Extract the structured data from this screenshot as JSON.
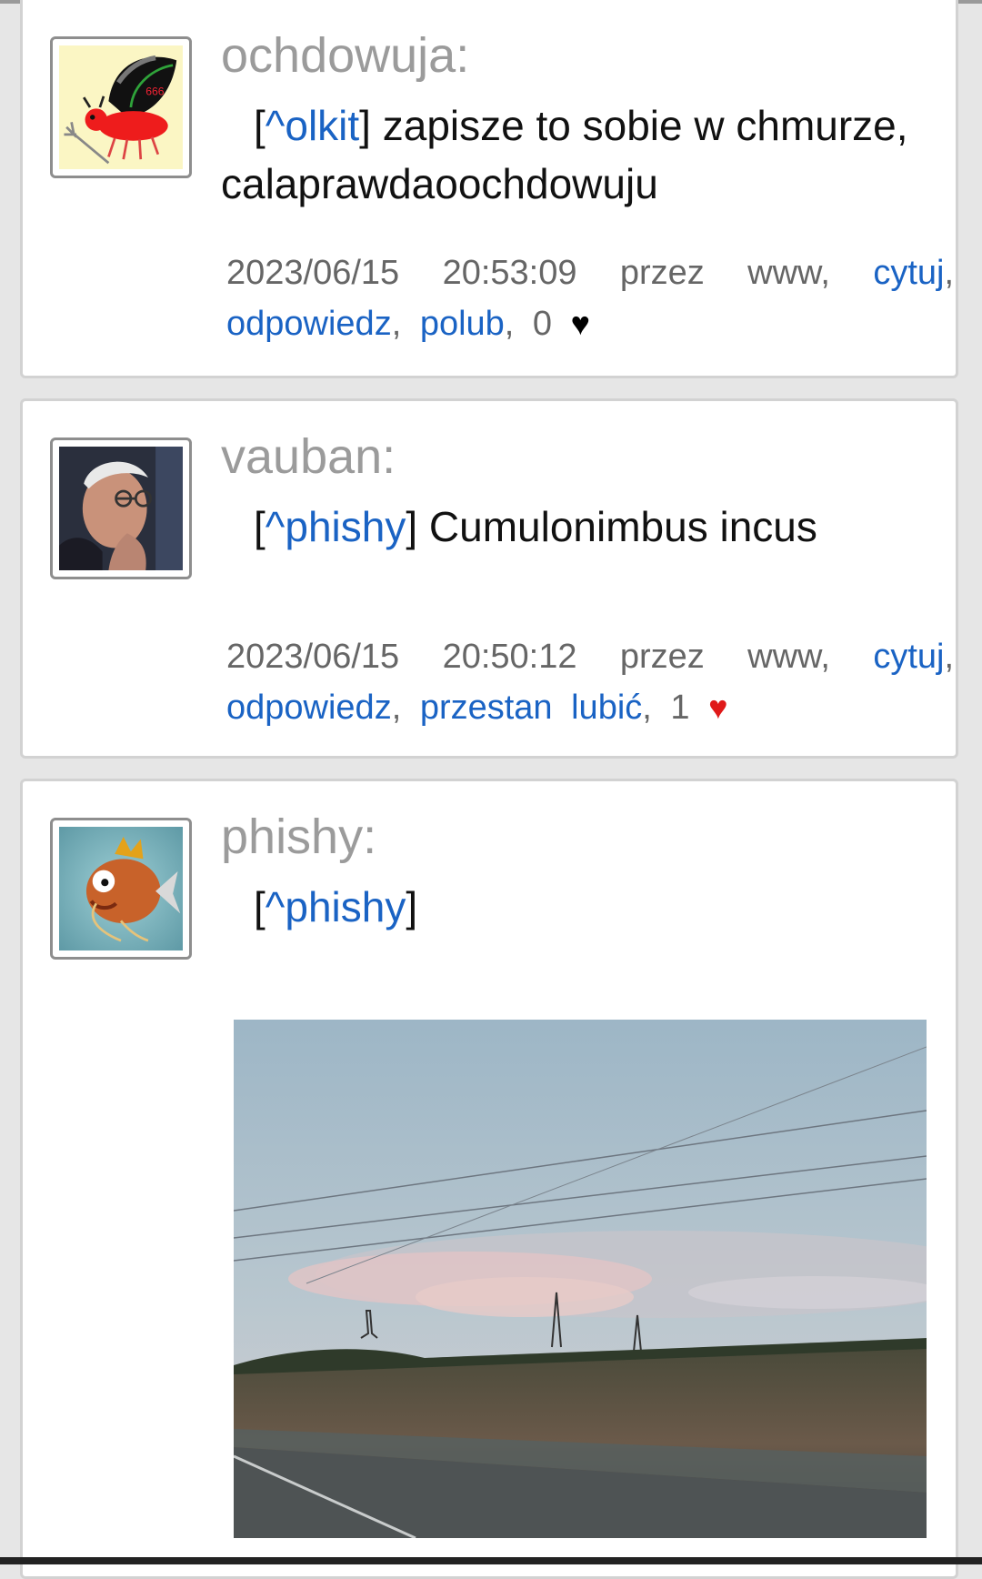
{
  "posts": [
    {
      "username": "ochdowuja:",
      "avatar": "devil-fly-avatar",
      "mention": "^olkit",
      "text": " zapisze to sobie w chmurze, calaprawdaoochdowuju",
      "date": "2023/06/15",
      "time": "20:53:09",
      "via": "przez www,",
      "quote_label": "cytuj",
      "reply_label": "odpowiedz",
      "like_label": "polub",
      "like_count": "0",
      "heart_color": "#000000"
    },
    {
      "username": "vauban:",
      "avatar": "elderly-man-avatar",
      "mention": "^phishy",
      "text": " Cumulonimbus incus",
      "date": "2023/06/15",
      "time": "20:50:12",
      "via": "przez www,",
      "quote_label": "cytuj",
      "reply_label": "odpowiedz",
      "like_label": "przestan lubić",
      "like_count": "1",
      "heart_color": "#e01919"
    },
    {
      "username": "phishy:",
      "avatar": "fish-avatar",
      "mention": "^phishy",
      "image": "cumulonimbus-cloud-photo"
    }
  ],
  "colors": {
    "link": "#1a63c4",
    "username": "#9b9b9b",
    "background": "#e6e6e6"
  }
}
